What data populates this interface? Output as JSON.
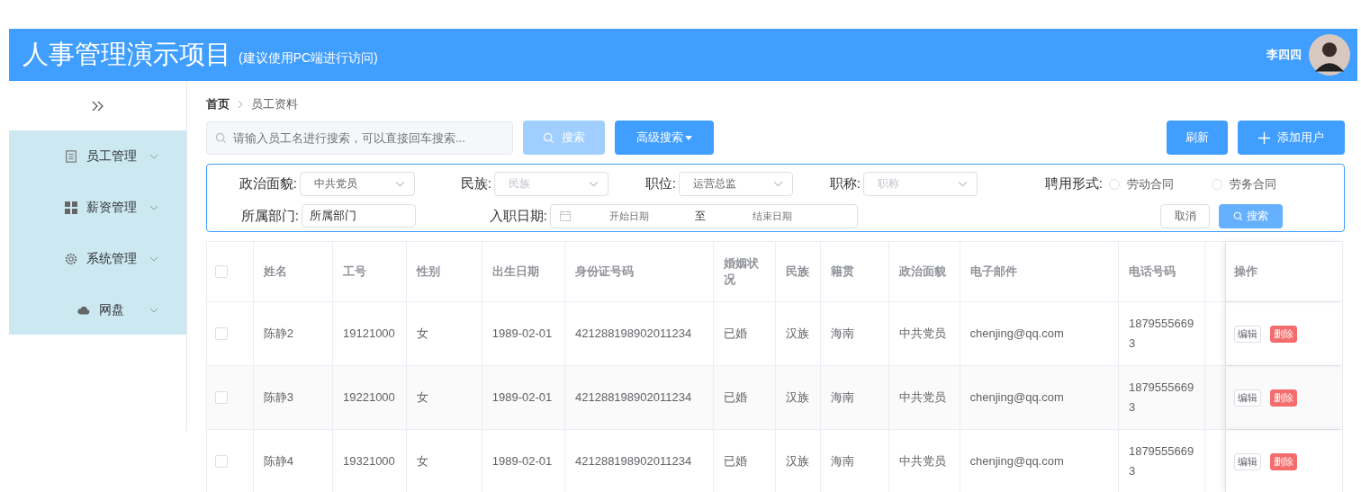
{
  "header": {
    "title": "人事管理演示项目",
    "subtitle": "(建议使用PC端进行访问)",
    "user_name": "李四四"
  },
  "sidebar": {
    "items": [
      {
        "label": "员工管理"
      },
      {
        "label": "薪资管理"
      },
      {
        "label": "系统管理"
      },
      {
        "label": "网盘"
      }
    ]
  },
  "breadcrumb": [
    "首页",
    "员工资料"
  ],
  "toolbar": {
    "search": {
      "placeholder": "请输入员工名进行搜索，可以直接回车搜索..."
    },
    "search_button": {
      "label": "搜索",
      "disabled": true
    },
    "advanced_button": "高级搜索",
    "refresh_button": "刷新",
    "add_button": "添加用户"
  },
  "filters": {
    "row_1": [
      {
        "kind": "select",
        "label": "政治面貌:",
        "value": "中共党员"
      },
      {
        "kind": "select",
        "label": "民族:",
        "placeholder": "民族"
      },
      {
        "kind": "select",
        "label": "职位:",
        "value": "运营总监"
      },
      {
        "kind": "select",
        "label": "职称:",
        "placeholder": "职称"
      },
      {
        "kind": "radio",
        "label": "聘用形式:",
        "options": [
          {
            "label": "劳动合同",
            "selected": false
          },
          {
            "label": "劳务合同",
            "selected": false
          }
        ]
      }
    ],
    "row_2": [
      {
        "kind": "input",
        "label": "所属部门:",
        "value": "所属部门"
      },
      {
        "kind": "daterange",
        "label": "入职日期:",
        "start_placeholder": "开始日期",
        "separator": "至",
        "end_placeholder": "结束日期"
      }
    ],
    "cancel_button": "取消",
    "search_button": "搜索"
  },
  "table": {
    "select_all_checked": false,
    "columns": [
      "姓名",
      "工号",
      "性别",
      "出生日期",
      "身份证号码",
      "婚姻状况",
      "民族",
      "籍贯",
      "政治面貌",
      "电子邮件",
      "电话号码"
    ],
    "actions_header": "操作",
    "rows": [
      {
        "checked": false,
        "cells": [
          "陈静2",
          "19121000",
          "女",
          "1989-02-01",
          "421288198902011234",
          "已婚",
          "汉族",
          "海南",
          "中共党员",
          "chenjing@qq.com",
          "18795556693"
        ],
        "actions": [
          "编辑",
          "删除"
        ]
      },
      {
        "checked": false,
        "cells": [
          "陈静3",
          "19221000",
          "女",
          "1989-02-01",
          "421288198902011234",
          "已婚",
          "汉族",
          "海南",
          "中共党员",
          "chenjing@qq.com",
          "18795556693"
        ],
        "actions": [
          "编辑",
          "删除"
        ]
      },
      {
        "checked": false,
        "cells": [
          "陈静4",
          "19321000",
          "女",
          "1989-02-01",
          "421288198902011234",
          "已婚",
          "汉族",
          "海南",
          "中共党员",
          "chenjing@qq.com",
          "18795556693"
        ],
        "actions": [
          "编辑",
          "删除"
        ]
      }
    ]
  }
}
